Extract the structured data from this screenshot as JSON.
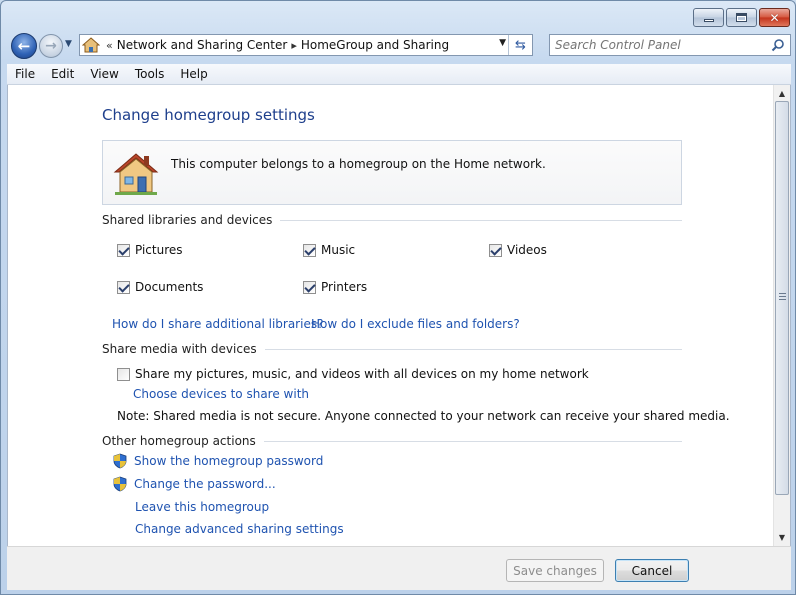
{
  "window": {
    "caption_buttons": {
      "minimize": "minimize",
      "maximize": "maximize",
      "close": "close"
    }
  },
  "nav": {
    "back_icon": "back-arrow-icon",
    "forward_icon": "forward-arrow-icon"
  },
  "address": {
    "overflow": "«",
    "crumbs": [
      "Network and Sharing Center",
      "HomeGroup and Sharing"
    ],
    "separator": "▸"
  },
  "search": {
    "placeholder": "Search Control Panel"
  },
  "menu": {
    "items": [
      "File",
      "Edit",
      "View",
      "Tools",
      "Help"
    ]
  },
  "page": {
    "title": "Change homegroup settings",
    "info_text": "This computer belongs to a homegroup on the Home network."
  },
  "shared_libraries": {
    "heading": "Shared libraries and devices",
    "items": [
      {
        "label": "Pictures",
        "checked": true
      },
      {
        "label": "Music",
        "checked": true
      },
      {
        "label": "Videos",
        "checked": true
      },
      {
        "label": "Documents",
        "checked": true
      },
      {
        "label": "Printers",
        "checked": true
      }
    ],
    "links": [
      "How do I share additional libraries?",
      "How do I exclude files and folders?"
    ]
  },
  "media": {
    "heading": "Share media with devices",
    "checkbox_label": "Share my pictures, music, and videos with all devices on my home network",
    "checked": false,
    "choose_link": "Choose devices to share with",
    "note": "Note: Shared media is not secure. Anyone connected to your network can receive your shared media."
  },
  "other_actions": {
    "heading": "Other homegroup actions",
    "items": [
      {
        "label": "Show the homegroup password",
        "icon": "shield-icon"
      },
      {
        "label": "Change the password...",
        "icon": "shield-icon"
      },
      {
        "label": "Leave this homegroup",
        "icon": ""
      },
      {
        "label": "Change advanced sharing settings",
        "icon": ""
      }
    ]
  },
  "footer": {
    "save_label": "Save changes",
    "cancel_label": "Cancel"
  },
  "colors": {
    "link": "#1f53b0",
    "title": "#1e3f8c",
    "accent": "#2f62b5"
  }
}
